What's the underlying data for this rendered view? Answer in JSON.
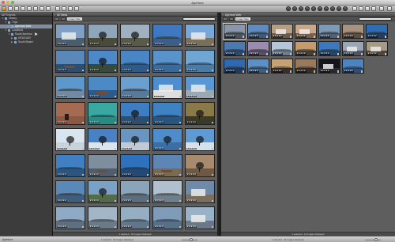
{
  "window": {
    "title": "Aperture"
  },
  "sidebar": {
    "header": "All Projects",
    "items": [
      {
        "label": "Library",
        "depth": 0,
        "expanded": true,
        "selected": false
      },
      {
        "label": "Trips",
        "depth": 1,
        "expanded": true,
        "selected": false
      },
      {
        "label": "Aperture Web",
        "depth": 2,
        "expanded": false,
        "selected": true
      },
      {
        "label": "Locations",
        "depth": 1,
        "expanded": true,
        "selected": false
      },
      {
        "label": "South America",
        "depth": 2,
        "expanded": true,
        "selected": false
      },
      {
        "label": "URUGUAY",
        "depth": 3,
        "expanded": false,
        "selected": false
      },
      {
        "label": "South Beach",
        "depth": 3,
        "expanded": false,
        "selected": false
      }
    ]
  },
  "panes": {
    "all": {
      "tab_label": "All Views",
      "filter_select": "Image Date",
      "status": "1 selected · 94 images displayed"
    },
    "selected": {
      "tab_label": "Aperture Web",
      "filter_select": "Image Date",
      "status": "1 selected · 24 images displayed"
    }
  },
  "bottombar": {
    "label": "Aperture",
    "left_info": "1 selected · 94 images displayed",
    "right_info": "1 selected · 24 images displayed"
  },
  "thumb_stars": "★★★★★",
  "thumbs_all": [
    {
      "kind": "bldg",
      "sky": "#7f9fc4",
      "ground": "#4b5e70",
      "sel": false
    },
    {
      "kind": "tree",
      "sky": "#8fa5ba",
      "ground": "#4a4a3a",
      "sel": false
    },
    {
      "kind": "tree",
      "sky": "#9fb0c0",
      "ground": "#5a5a4a",
      "sel": false
    },
    {
      "kind": "hill",
      "sky": "#3e78c0",
      "ground": "#3b5f88",
      "sel": false
    },
    {
      "kind": "bldg",
      "sky": "#79a8d8",
      "ground": "#7a6f5a",
      "sel": false
    },
    {
      "kind": "boat",
      "sky": "#5a88b8",
      "ground": "#2e4e70",
      "sel": false
    },
    {
      "kind": "tree",
      "sky": "#4d88c8",
      "ground": "#3a4a3a",
      "sel": false
    },
    {
      "kind": "hill",
      "sky": "#4a86c6",
      "ground": "#2e5a8a",
      "sel": false
    },
    {
      "kind": "hill",
      "sky": "#5a92cc",
      "ground": "#3a6a9a",
      "sel": false
    },
    {
      "kind": "hill",
      "sky": "#70a6d4",
      "ground": "#4a7aa6",
      "sel": false
    },
    {
      "kind": "hill",
      "sky": "#5c98cc",
      "ground": "#6f8aa4",
      "sel": false
    },
    {
      "kind": "boat",
      "sky": "#4c8ac6",
      "ground": "#2e5a8a",
      "sel": false
    },
    {
      "kind": "hill",
      "sky": "#6aa0d0",
      "ground": "#587a9a",
      "sel": false
    },
    {
      "kind": "bldg",
      "sky": "#4d8ed0",
      "ground": "#dedede",
      "sel": false
    },
    {
      "kind": "bldg",
      "sky": "#5a98d4",
      "ground": "#9aa8b4",
      "sel": false
    },
    {
      "kind": "door",
      "sky": "#a46a52",
      "ground": "#8a5a46",
      "sel": false
    },
    {
      "kind": "hill",
      "sky": "#38a8a0",
      "ground": "#2a8a84",
      "sel": false
    },
    {
      "kind": "tree",
      "sky": "#3e7ec0",
      "ground": "#2e4e6e",
      "sel": false
    },
    {
      "kind": "hill",
      "sky": "#3f82c4",
      "ground": "#29557f",
      "sel": false
    },
    {
      "kind": "tree",
      "sky": "#8a7a4a",
      "ground": "#3a3a2a",
      "sel": false
    },
    {
      "kind": "tree",
      "sky": "#d8e4ee",
      "ground": "#c8d2da",
      "sel": false
    },
    {
      "kind": "tree",
      "sky": "#4a80c4",
      "ground": "#dbe4ee",
      "sel": false
    },
    {
      "kind": "tree",
      "sky": "#6a94c2",
      "ground": "#bfcad6",
      "sel": false
    },
    {
      "kind": "tree",
      "sky": "#4e8ccc",
      "ground": "#3a6ea4",
      "sel": false
    },
    {
      "kind": "tree",
      "sky": "#5e9ad4",
      "ground": "#d6e0ea",
      "sel": false
    },
    {
      "kind": "hill",
      "sky": "#3f7fc2",
      "ground": "#2b5680",
      "sel": false
    },
    {
      "kind": "boat",
      "sky": "#7e8e9c",
      "ground": "#4e5e6c",
      "sel": false
    },
    {
      "kind": "hill",
      "sky": "#2e72be",
      "ground": "#244a74",
      "sel": false
    },
    {
      "kind": "boat",
      "sky": "#5e86b4",
      "ground": "#7a6a52",
      "sel": false
    },
    {
      "kind": "tree",
      "sky": "#a88a6e",
      "ground": "#6e5a44",
      "sel": false
    },
    {
      "kind": "hill",
      "sky": "#5a88b8",
      "ground": "#3e5e7e",
      "sel": false
    },
    {
      "kind": "tree",
      "sky": "#7aa2c6",
      "ground": "#536b4a",
      "sel": false
    },
    {
      "kind": "hill",
      "sky": "#8aa4ba",
      "ground": "#5a6e7e",
      "sel": false
    },
    {
      "kind": "hill",
      "sky": "#b0c0ce",
      "ground": "#6e7e8a",
      "sel": false
    },
    {
      "kind": "bldg",
      "sky": "#6e8aa8",
      "ground": "#7a6e5e",
      "sel": false
    },
    {
      "kind": "hill",
      "sky": "#8eaac4",
      "ground": "#5e7080",
      "sel": false
    },
    {
      "kind": "hill",
      "sky": "#a2b6c8",
      "ground": "#6a7a86",
      "sel": false
    },
    {
      "kind": "hill",
      "sky": "#96aec2",
      "ground": "#62768a",
      "sel": false
    },
    {
      "kind": "hill",
      "sky": "#7e9cb8",
      "ground": "#56708a",
      "sel": false
    },
    {
      "kind": "bldg",
      "sky": "#9ab2c8",
      "ground": "#6a7888",
      "sel": false
    }
  ],
  "thumbs_sel": [
    {
      "kind": "hill",
      "sky": "#8898aa",
      "ground": "#4a5462",
      "sel": true
    },
    {
      "kind": "hill",
      "sky": "#5e8cc0",
      "ground": "#3a5a82",
      "sel": false
    },
    {
      "kind": "bldg",
      "sky": "#b69e86",
      "ground": "#6a5a4a",
      "sel": false
    },
    {
      "kind": "bldg",
      "sky": "#c8a88a",
      "ground": "#7a604a",
      "sel": false
    },
    {
      "kind": "hill",
      "sky": "#7c9ab8",
      "ground": "#4a627c",
      "sel": false
    },
    {
      "kind": "hill",
      "sky": "#a8927e",
      "ground": "#5e4e40",
      "sel": false
    },
    {
      "kind": "hill",
      "sky": "#2e6cb4",
      "ground": "#1e3e6a",
      "sel": false
    },
    {
      "kind": "hill",
      "sky": "#4a7ab2",
      "ground": "#2a4a74",
      "sel": false
    },
    {
      "kind": "hill",
      "sky": "#9a8cb0",
      "ground": "#5a4e6e",
      "sel": false
    },
    {
      "kind": "hill",
      "sky": "#b4c6d8",
      "ground": "#6a7e94",
      "sel": false
    },
    {
      "kind": "hill",
      "sky": "#c69a6a",
      "ground": "#4a3e34",
      "sel": false
    },
    {
      "kind": "hill",
      "sky": "#3a78c0",
      "ground": "#22466e",
      "sel": false
    },
    {
      "kind": "bldg",
      "sky": "#9aa6b4",
      "ground": "#4c5662",
      "sel": false
    },
    {
      "kind": "bldg",
      "sky": "#a69a86",
      "ground": "#504638",
      "sel": false
    },
    {
      "kind": "hill",
      "sky": "#2e6ab4",
      "ground": "#1c3c66",
      "sel": false
    },
    {
      "kind": "hill",
      "sky": "#5a90c8",
      "ground": "#3a5e86",
      "sel": false
    },
    {
      "kind": "hill",
      "sky": "#c6a270",
      "ground": "#3a3028",
      "sel": false
    },
    {
      "kind": "hill",
      "sky": "#9a7a5a",
      "ground": "#3a2e24",
      "sel": false
    },
    {
      "kind": "bldg",
      "sky": "#14141a",
      "ground": "#2a2a30",
      "sel": false
    },
    {
      "kind": "hill",
      "sky": "#4a84c4",
      "ground": "#2a5080",
      "sel": false
    }
  ]
}
